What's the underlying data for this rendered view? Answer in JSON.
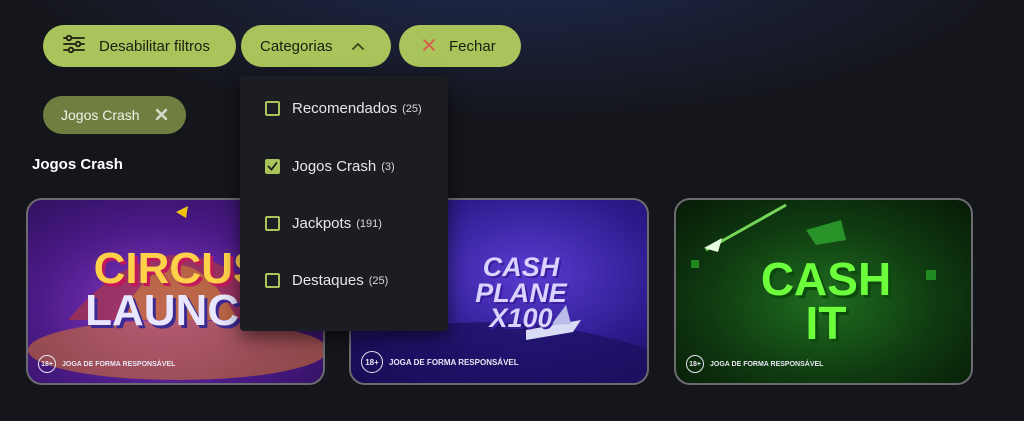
{
  "toolbar": {
    "disable_filters_label": "Desabilitar filtros",
    "categories_label": "Categorias",
    "close_label": "Fechar"
  },
  "active_filter": {
    "label": "Jogos Crash"
  },
  "section": {
    "title": "Jogos Crash"
  },
  "categories_dropdown": {
    "items": [
      {
        "label": "Recomendados",
        "count": "(25)",
        "checked": false
      },
      {
        "label": "Jogos Crash",
        "count": "(3)",
        "checked": true
      },
      {
        "label": "Jackpots",
        "count": "(191)",
        "checked": false
      },
      {
        "label": "Destaques",
        "count": "(25)",
        "checked": false
      }
    ]
  },
  "games": [
    {
      "logo_line1": "CIRCUS",
      "logo_line2": "LAUNCH",
      "badge": "18+",
      "notice": "JOGA DE FORMA RESPONSÁVEL"
    },
    {
      "logo_line1": "CASH",
      "logo_line2": "PLANE",
      "logo_line3": "X100",
      "badge": "18+",
      "notice": "JOGA DE FORMA RESPONSÁVEL"
    },
    {
      "logo_line1": "CASH",
      "logo_line2": "IT",
      "badge": "18+",
      "notice": "JOGA DE FORMA RESPONSÁVEL"
    }
  ],
  "colors": {
    "accent": "#a9c45a",
    "chip": "#6e7f3f",
    "background": "#15161c",
    "dropdown_bg": "#1c1d22",
    "close_x": "#e0524c"
  },
  "icons": {
    "disable_filters": "sliders-icon",
    "categories": "chevron-up-icon",
    "close": "close-icon",
    "chip_remove": "close-icon",
    "checked": "check-icon"
  }
}
